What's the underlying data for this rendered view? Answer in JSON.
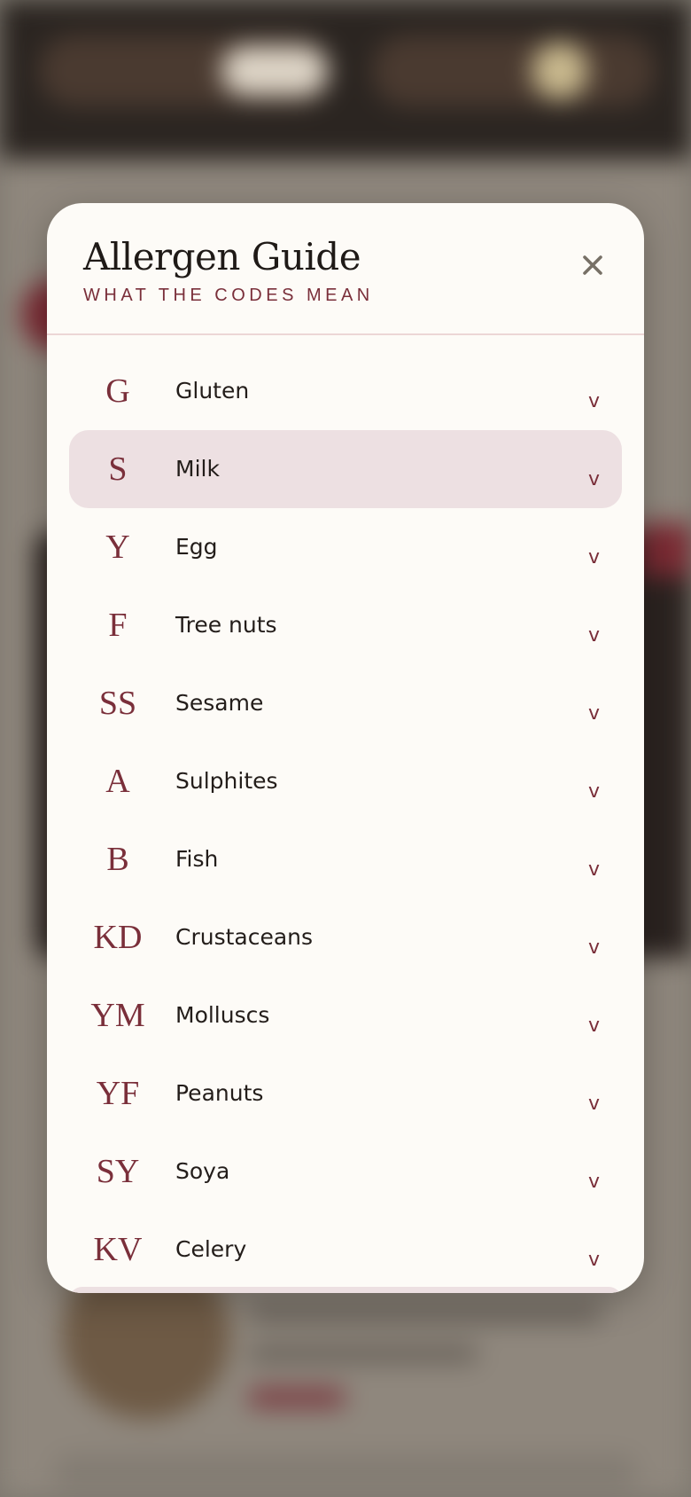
{
  "modal": {
    "title": "Allergen Guide",
    "subtitle": "WHAT THE CODES MEAN",
    "close_icon": "close-icon"
  },
  "allergens": [
    {
      "code": "G",
      "name": "Gluten",
      "expanded_indicator": "v",
      "selected": false
    },
    {
      "code": "S",
      "name": "Milk",
      "expanded_indicator": "v",
      "selected": true
    },
    {
      "code": "Y",
      "name": "Egg",
      "expanded_indicator": "v",
      "selected": false
    },
    {
      "code": "F",
      "name": "Tree nuts",
      "expanded_indicator": "v",
      "selected": false
    },
    {
      "code": "SS",
      "name": "Sesame",
      "expanded_indicator": "v",
      "selected": false
    },
    {
      "code": "A",
      "name": "Sulphites",
      "expanded_indicator": "v",
      "selected": false
    },
    {
      "code": "B",
      "name": "Fish",
      "expanded_indicator": "v",
      "selected": false
    },
    {
      "code": "KD",
      "name": "Crustaceans",
      "expanded_indicator": "v",
      "selected": false
    },
    {
      "code": "YM",
      "name": "Molluscs",
      "expanded_indicator": "v",
      "selected": false
    },
    {
      "code": "YF",
      "name": "Peanuts",
      "expanded_indicator": "v",
      "selected": false
    },
    {
      "code": "SY",
      "name": "Soya",
      "expanded_indicator": "v",
      "selected": false
    },
    {
      "code": "KV",
      "name": "Celery",
      "expanded_indicator": "v",
      "selected": false
    }
  ],
  "colors": {
    "accent": "#7a2f3a",
    "selected_row": "#ede0e2",
    "modal_bg": "#fdfbf7",
    "divider": "#ecd6d6",
    "close_icon": "#777066"
  }
}
